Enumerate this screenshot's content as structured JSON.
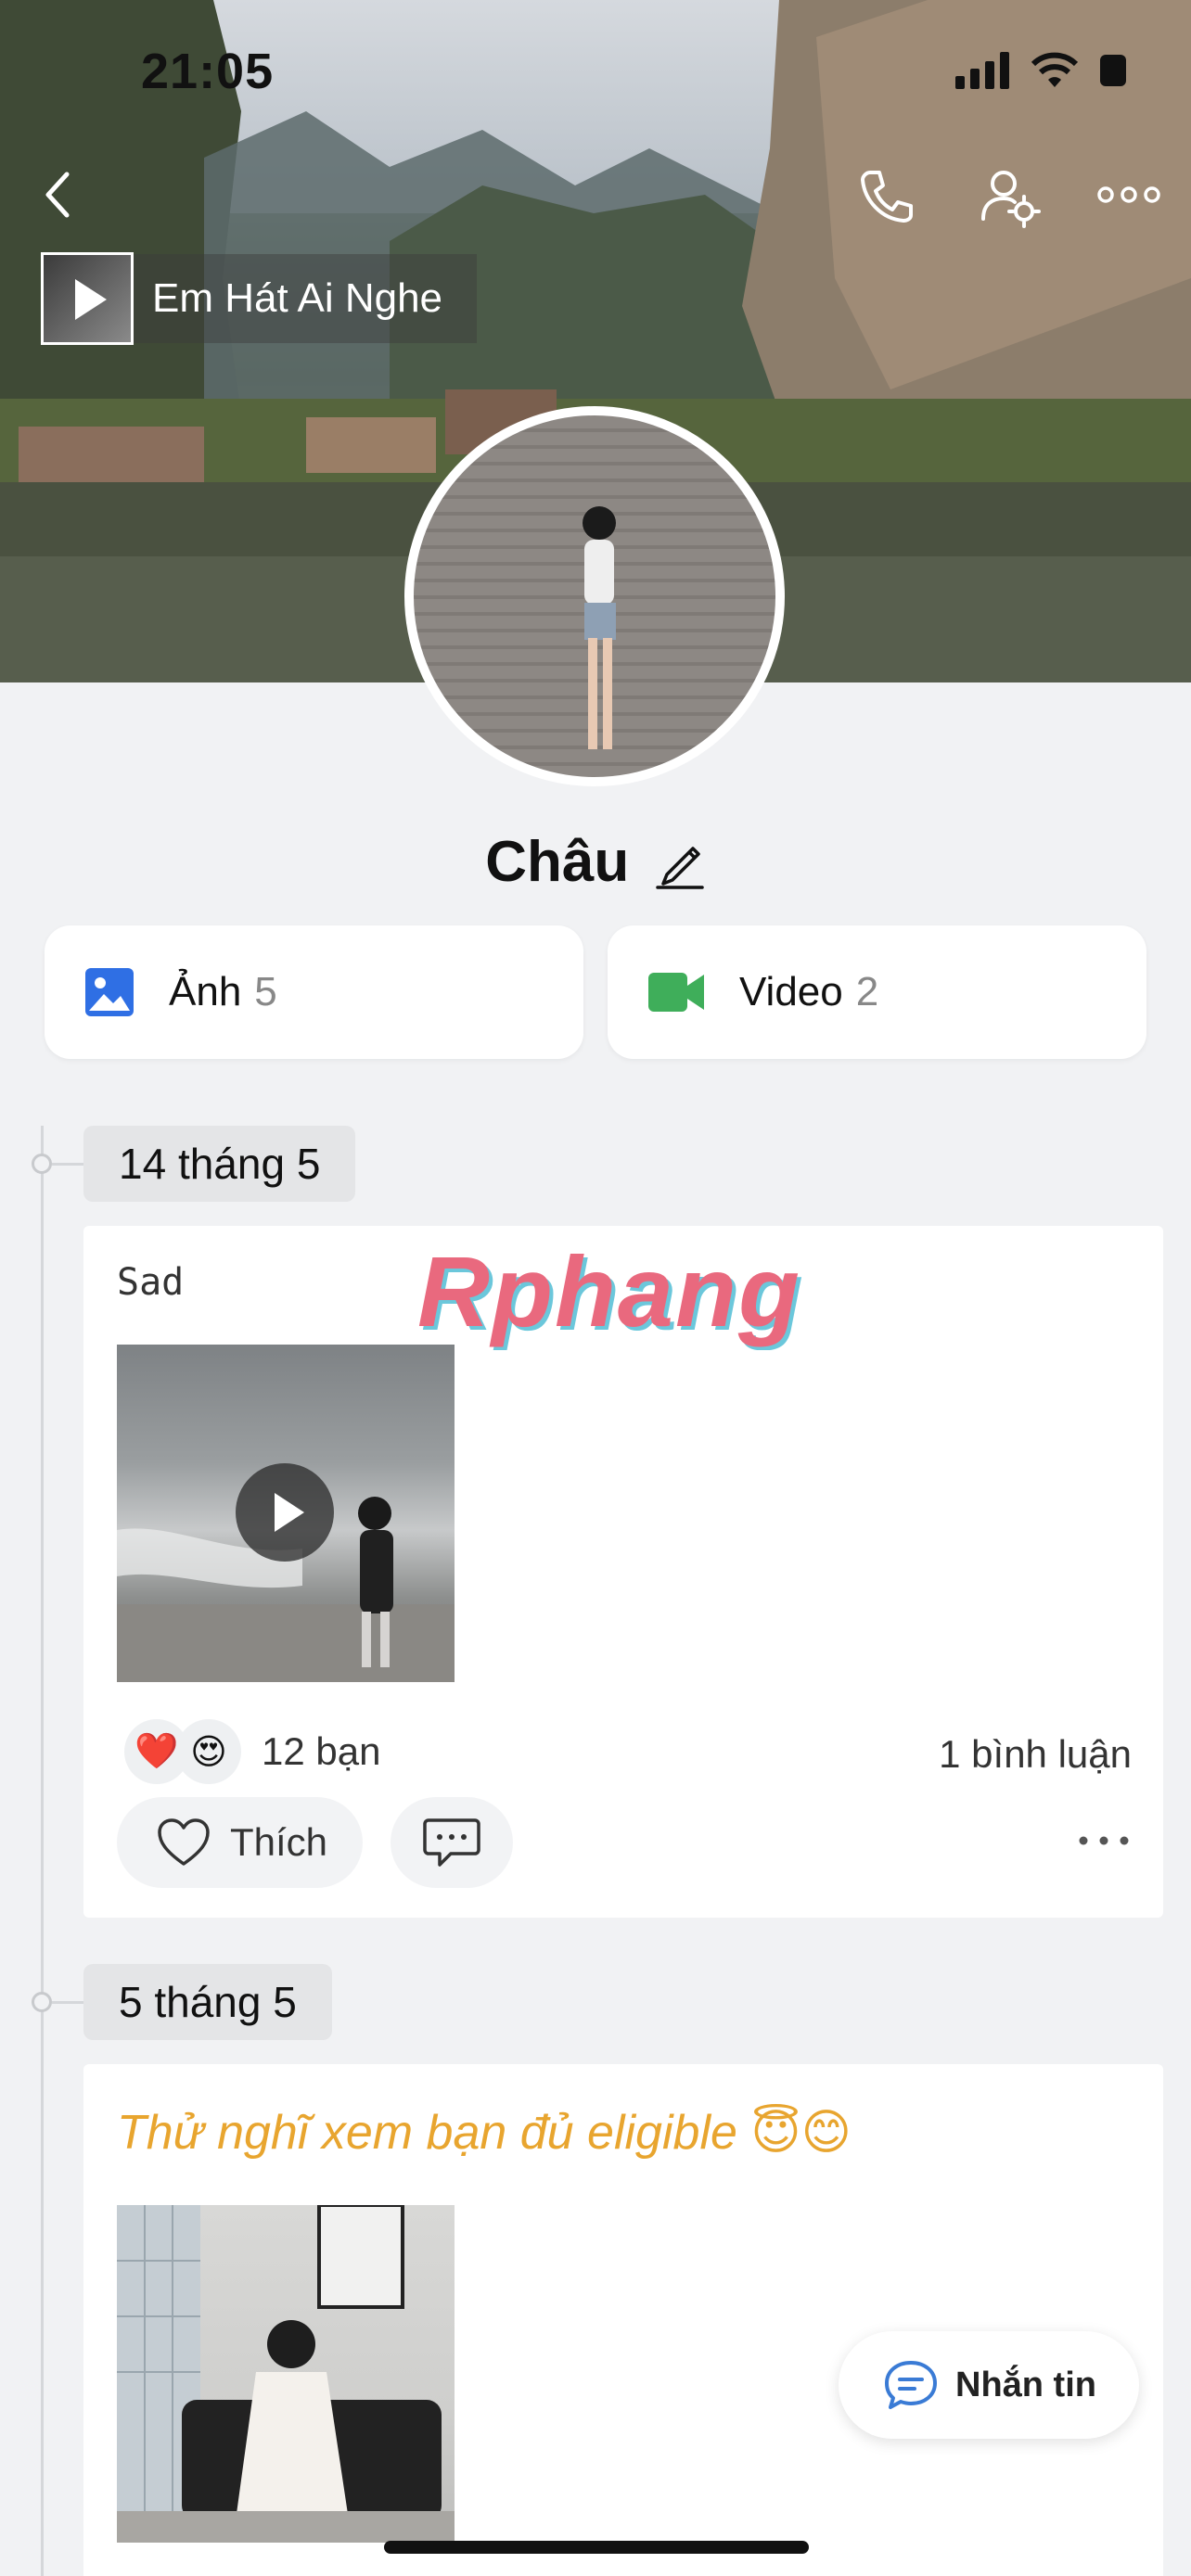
{
  "status_bar": {
    "time": "21:05"
  },
  "cover": {
    "music_title": "Em Hát Ai Nghe"
  },
  "profile": {
    "name": "Châu"
  },
  "media_summary": [
    {
      "label": "Ảnh",
      "count": "5",
      "icon": "photo-icon",
      "color": "#2f6fe4"
    },
    {
      "label": "Video",
      "count": "2",
      "icon": "video-camera-icon",
      "color": "#3fae5a"
    }
  ],
  "watermark": "Rphang",
  "posts": [
    {
      "date": "14 tháng 5",
      "text": "Sad",
      "media_type": "video",
      "reactions": [
        "❤️",
        "😍"
      ],
      "reaction_count": "12 bạn",
      "comment_count": "1 bình luận",
      "like_label": "Thích"
    },
    {
      "date": "5 tháng 5",
      "text": "Thử nghĩ xem bạn đủ eligible 😇😊",
      "text_color": "#e8a52f",
      "media_type": "photo"
    }
  ],
  "fab": {
    "label": "Nhắn tin"
  }
}
